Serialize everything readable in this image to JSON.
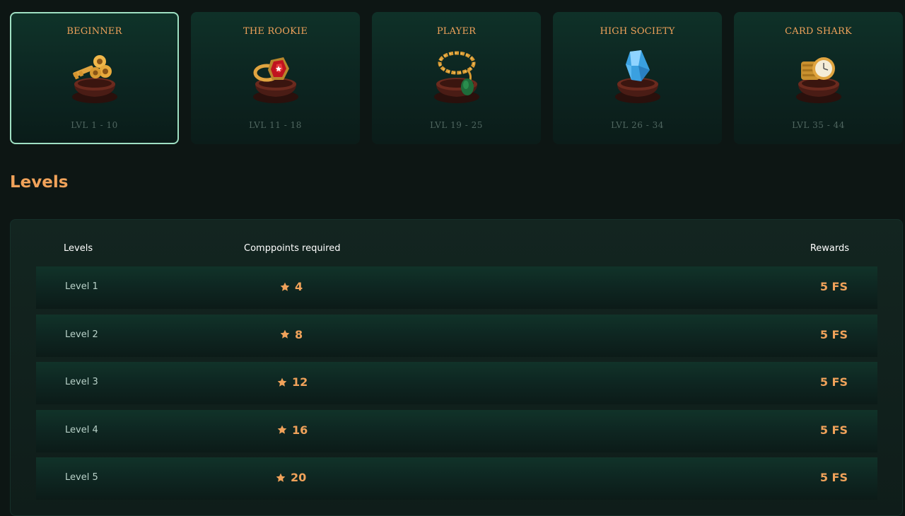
{
  "tiers": [
    {
      "name": "BEGINNER",
      "range": "LVL 1 - 10",
      "icon": "golden-key-icon",
      "active": true
    },
    {
      "name": "THE ROOKIE",
      "range": "LVL 11 - 18",
      "icon": "ruby-ring-icon",
      "active": false
    },
    {
      "name": "PLAYER",
      "range": "LVL 19 - 25",
      "icon": "gold-chain-icon",
      "active": false
    },
    {
      "name": "HIGH SOCIETY",
      "range": "LVL 26 - 34",
      "icon": "blue-diamond-icon",
      "active": false
    },
    {
      "name": "CARD SHARK",
      "range": "LVL 35 - 44",
      "icon": "gold-watch-icon",
      "active": false
    }
  ],
  "section_title": "Levels",
  "table": {
    "headers": {
      "levels": "Levels",
      "points": "Comppoints required",
      "rewards": "Rewards"
    },
    "rows": [
      {
        "level": "Level 1",
        "points": "4",
        "reward": "5 FS"
      },
      {
        "level": "Level 2",
        "points": "8",
        "reward": "5 FS"
      },
      {
        "level": "Level 3",
        "points": "12",
        "reward": "5 FS"
      },
      {
        "level": "Level 4",
        "points": "16",
        "reward": "5 FS"
      },
      {
        "level": "Level 5",
        "points": "20",
        "reward": "5 FS"
      }
    ]
  },
  "colors": {
    "accent": "#f0a25a",
    "active_border": "#9fe0c3",
    "background": "#0d1614"
  }
}
